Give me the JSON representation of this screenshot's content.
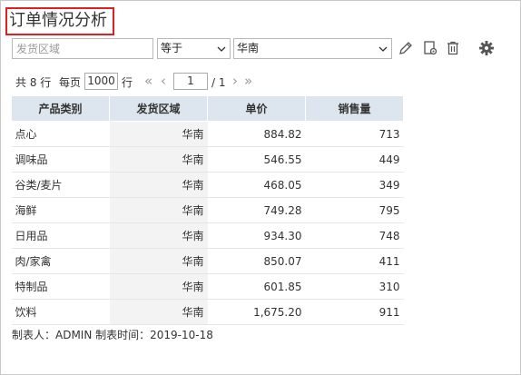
{
  "page": {
    "title": "订单情况分析"
  },
  "filter": {
    "field_placeholder": "发货区域",
    "operator": "等于",
    "value": "华南"
  },
  "toolbar": {
    "icons": [
      "edit-icon",
      "settings-doc-icon",
      "delete-icon",
      "gear-icon"
    ]
  },
  "pager": {
    "total_label": "共 8 行",
    "per_page_label": "每页",
    "page_size": "1000",
    "row_unit": "行",
    "first_glyph": "«",
    "prev_glyph": "‹",
    "current_page": "1",
    "total_pages": "/ 1",
    "next_glyph": "›",
    "last_glyph": "»"
  },
  "table": {
    "columns": [
      "产品类别",
      "发货区域",
      "单价",
      "销售量"
    ],
    "rows": [
      [
        "点心",
        "华南",
        "884.82",
        "713"
      ],
      [
        "调味品",
        "华南",
        "546.55",
        "449"
      ],
      [
        "谷类/麦片",
        "华南",
        "468.05",
        "349"
      ],
      [
        "海鲜",
        "华南",
        "749.28",
        "795"
      ],
      [
        "日用品",
        "华南",
        "934.30",
        "748"
      ],
      [
        "肉/家禽",
        "华南",
        "850.07",
        "411"
      ],
      [
        "特制品",
        "华南",
        "601.85",
        "310"
      ],
      [
        "饮料",
        "华南",
        "1,675.20",
        "911"
      ]
    ]
  },
  "footer": {
    "text": "制表人：ADMIN  制表时间：2019-10-18"
  },
  "colors": {
    "title_border": "#e02020",
    "header_bg": "#dde6ee",
    "region_col_bg": "#f3f3f3"
  }
}
